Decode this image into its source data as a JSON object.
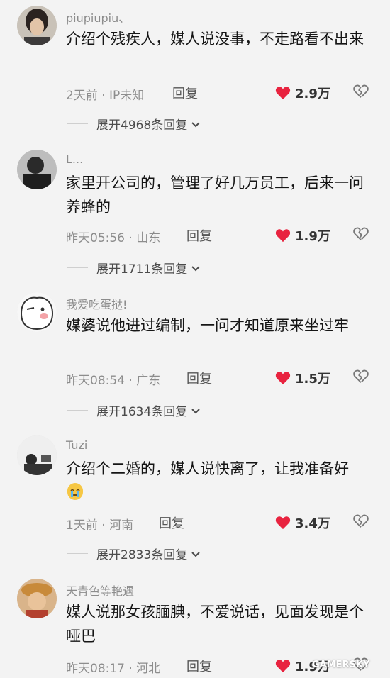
{
  "comments": [
    {
      "username": "piupiupiu、",
      "text": "介绍个残疾人，媒人说没事，不走路看不出来",
      "meta": "2天前 · IP未知",
      "reply_label": "回复",
      "likes": "2.9万",
      "expand_label": "展开4968条回复"
    },
    {
      "username": "L...",
      "text": "家里开公司的，管理了好几万员工，后来一问养蜂的",
      "meta": "昨天05:56 · 山东",
      "reply_label": "回复",
      "likes": "1.9万",
      "expand_label": "展开1711条回复"
    },
    {
      "username": "我爱吃蛋挞!",
      "text": "媒婆说他进过编制，一问才知道原来坐过牢",
      "meta": "昨天08:54 · 广东",
      "reply_label": "回复",
      "likes": "1.5万",
      "expand_label": "展开1634条回复"
    },
    {
      "username": "Tuzi",
      "text": "介绍个二婚的，媒人说快离了，让我准备好",
      "meta": "1天前 · 河南",
      "reply_label": "回复",
      "likes": "3.4万",
      "expand_label": "展开2833条回复"
    },
    {
      "username": "天青色等艳遇",
      "text": "媒人说那女孩腼腆，不爱说话，见面发现是个哑巴",
      "meta": "昨天08:17 · 河北",
      "reply_label": "回复",
      "likes": "1.9万"
    }
  ],
  "colors": {
    "like": "#e8233f",
    "text": "#151515",
    "meta": "#8d8d8d"
  },
  "icons": [
    "heart-icon",
    "broken-heart-icon",
    "chevron-down-icon",
    "crying-emoji-icon"
  ],
  "watermark": "GAMERSKY"
}
